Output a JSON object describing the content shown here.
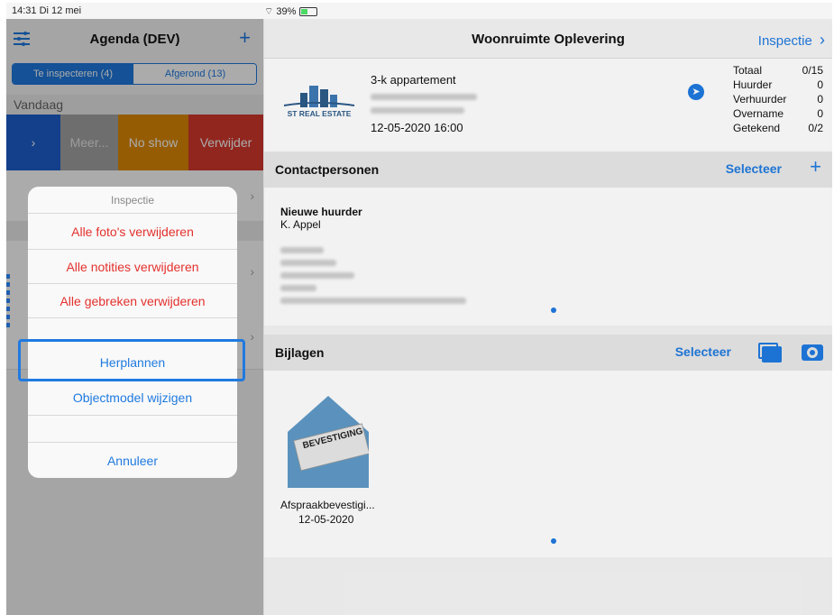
{
  "status": {
    "time": "14:31  Di 12 mei",
    "battery": "39%"
  },
  "left": {
    "title": "Agenda (DEV)",
    "tabs": [
      {
        "label": "Te inspecteren (4)"
      },
      {
        "label": "Afgerond (13)"
      }
    ],
    "section": "Vandaag",
    "swipe_actions": [
      {
        "label": "›",
        "color": "#1f5fd0"
      },
      {
        "label": "Meer...",
        "color": "#a5a5a5"
      },
      {
        "label": "No show",
        "color": "#de8a07"
      },
      {
        "label": "Verwijder",
        "color": "#d93a2e"
      }
    ]
  },
  "action_sheet": {
    "title": "Inspectie",
    "items": [
      {
        "label": "Alle foto's verwijderen",
        "style": "destructive"
      },
      {
        "label": "Alle notities verwijderen",
        "style": "destructive"
      },
      {
        "label": "Alle gebreken verwijderen",
        "style": "destructive"
      },
      {
        "label": "Herplannen",
        "style": "default"
      },
      {
        "label": "Objectmodel wijzigen",
        "style": "default"
      }
    ],
    "cancel": "Annuleer"
  },
  "right": {
    "title": "Woonruimte Oplevering",
    "nav_action": "Inspectie",
    "property": {
      "type": "3-k appartement",
      "datetime": "12-05-2020 16:00",
      "logo": "ST REAL ESTATE"
    },
    "stats": [
      {
        "label": "Totaal",
        "value": "0/15"
      },
      {
        "label": "Huurder",
        "value": "0"
      },
      {
        "label": "Verhuurder",
        "value": "0"
      },
      {
        "label": "Overname",
        "value": "0"
      },
      {
        "label": "Getekend",
        "value": "0/2"
      }
    ],
    "contacts": {
      "title": "Contactpersonen",
      "action": "Selecteer",
      "role": "Nieuwe huurder",
      "name": "K. Appel"
    },
    "attachments": {
      "title": "Bijlagen",
      "action": "Selecteer",
      "file": "Afspraakbevestigi...",
      "date": "12-05-2020",
      "stamp": "BEVESTIGING"
    }
  }
}
